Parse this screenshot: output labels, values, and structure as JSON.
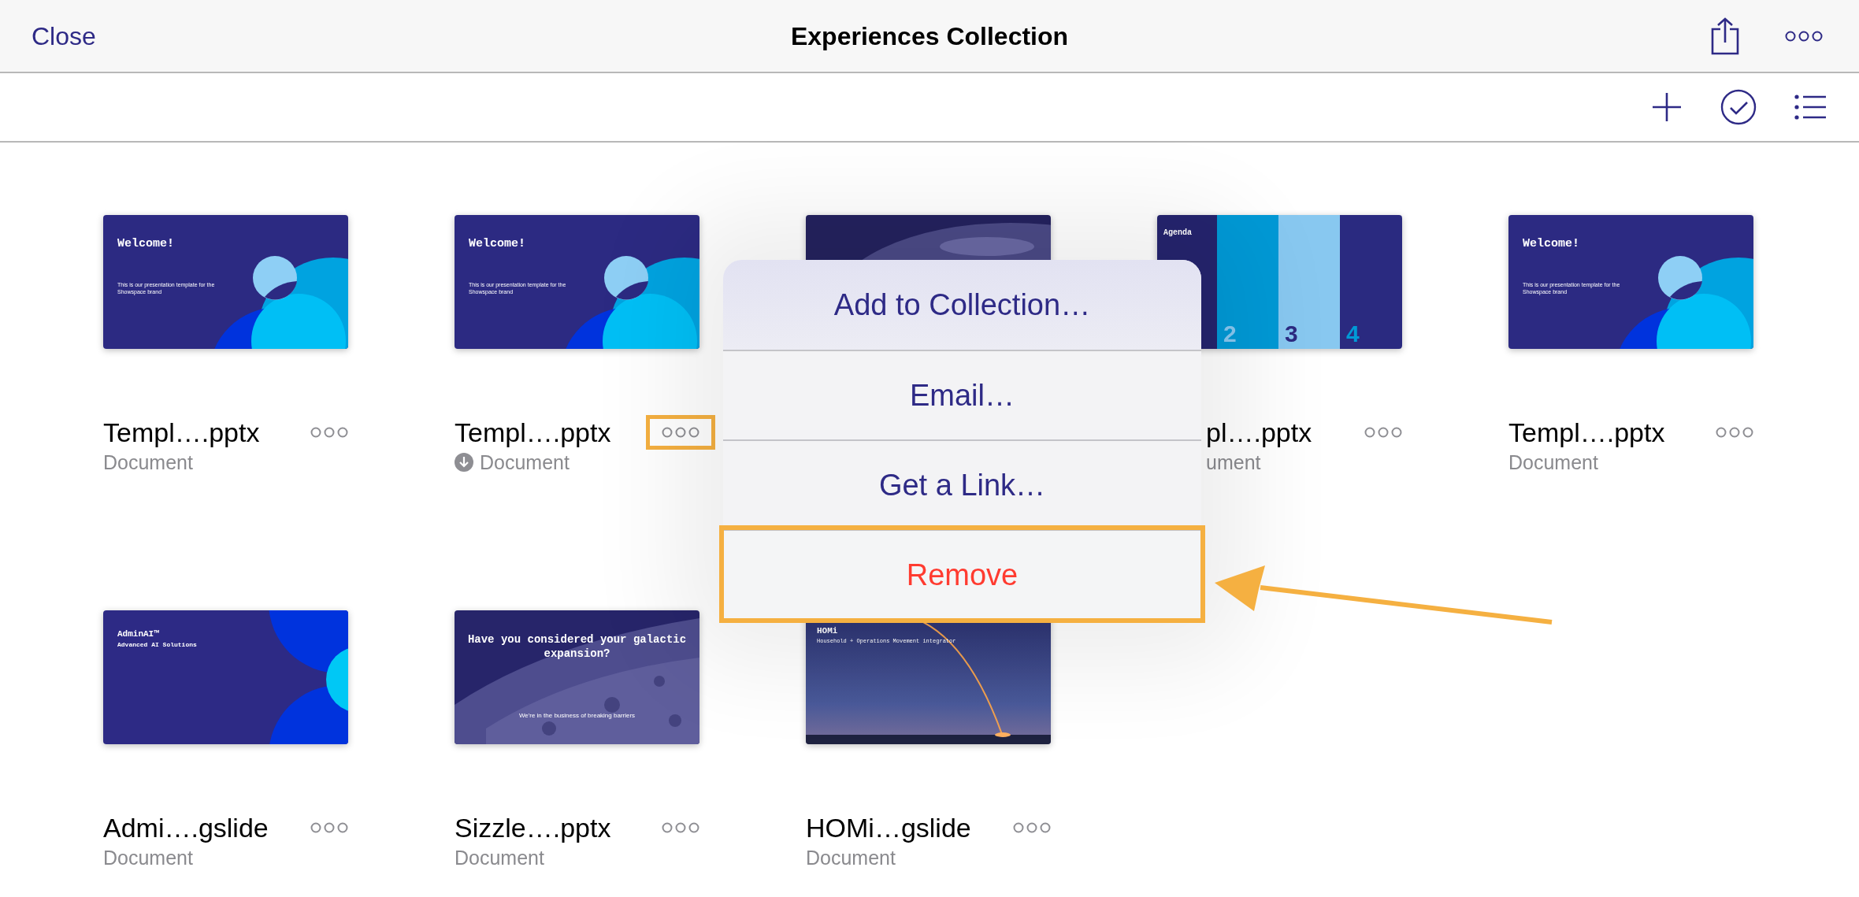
{
  "top_bar": {
    "close": "Close",
    "title": "Experiences Collection"
  },
  "items": [
    {
      "name": "Templ….pptx",
      "type": "Document",
      "downloaded": false,
      "menu_open": false,
      "partly_hidden": false,
      "thumbnail": {
        "kind": "welcome",
        "title": "Welcome!",
        "subtitle": "This is our presentation template for the Showspace brand"
      }
    },
    {
      "name": "Templ….pptx",
      "type": "Document",
      "downloaded": true,
      "menu_open": true,
      "partly_hidden": false,
      "thumbnail": {
        "kind": "welcome",
        "title": "Welcome!",
        "subtitle": "This is our presentation template for the Showspace brand"
      }
    },
    {
      "thumbnail": {
        "kind": "moon"
      }
    },
    {
      "name": "pl….pptx",
      "type": "ument",
      "downloaded": false,
      "menu_open": false,
      "partly_hidden": true,
      "thumbnail": {
        "kind": "agenda",
        "title": "Agenda",
        "numbers": [
          "2",
          "3",
          "4"
        ]
      }
    },
    {
      "name": "Templ….pptx",
      "type": "Document",
      "downloaded": false,
      "menu_open": false,
      "partly_hidden": false,
      "thumbnail": {
        "kind": "welcome",
        "title": "Welcome!",
        "subtitle": "This is our presentation template for the Showspace brand"
      }
    },
    {
      "name": "Admi….gslide",
      "type": "Document",
      "downloaded": false,
      "menu_open": false,
      "partly_hidden": false,
      "thumbnail": {
        "kind": "admin",
        "title": "AdminAI™",
        "subtitle": "Advanced AI Solutions"
      }
    },
    {
      "name": "Sizzle….pptx",
      "type": "Document",
      "downloaded": false,
      "menu_open": false,
      "partly_hidden": false,
      "thumbnail": {
        "kind": "galactic",
        "title": "Have you considered your galactic expansion?",
        "subtitle": "We're in the business of breaking barriers"
      }
    },
    {
      "name": "HOMi…gslide",
      "type": "Document",
      "downloaded": false,
      "menu_open": false,
      "partly_hidden": false,
      "thumbnail": {
        "kind": "homi",
        "title": "HOMi",
        "subtitle": "Household + Operations Movement integrator"
      }
    }
  ],
  "menu": {
    "items": [
      {
        "label": "Add to Collection…",
        "kind": "normal",
        "highlighted": false
      },
      {
        "label": "Email…",
        "kind": "normal",
        "highlighted": false
      },
      {
        "label": "Get a Link…",
        "kind": "normal",
        "highlighted": false
      },
      {
        "label": "Remove",
        "kind": "destructive",
        "highlighted": true
      }
    ]
  }
}
